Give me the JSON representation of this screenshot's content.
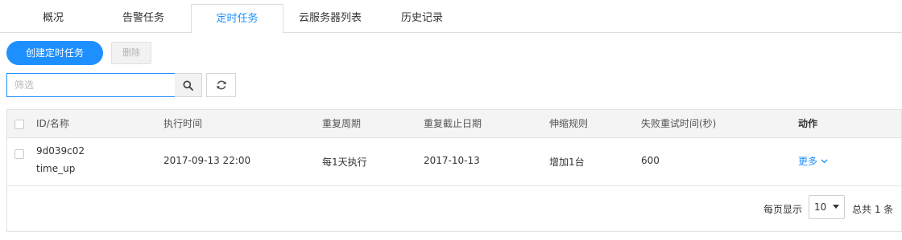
{
  "tabs": [
    {
      "label": "概况"
    },
    {
      "label": "告警任务"
    },
    {
      "label": "定时任务"
    },
    {
      "label": "云服务器列表"
    },
    {
      "label": "历史记录"
    }
  ],
  "toolbar": {
    "create_label": "创建定时任务",
    "delete_label": "删除"
  },
  "search": {
    "placeholder": "筛选"
  },
  "table": {
    "columns": [
      "ID/名称",
      "执行时间",
      "重复周期",
      "重复截止日期",
      "伸缩规则",
      "失败重试时间(秒)",
      "动作"
    ],
    "rows": [
      {
        "id": "9d039c02",
        "name": "time_up",
        "exec_time": "2017-09-13 22:00",
        "repeat": "每1天执行",
        "end_date": "2017-10-13",
        "rule": "增加1台",
        "retry": "600",
        "action": "更多"
      }
    ]
  },
  "pagination": {
    "per_page_label": "每页显示",
    "per_page_value": "10",
    "total_label": "总共 1 条"
  },
  "colors": {
    "accent": "#1e8fff",
    "header_bg": "#f4f4f4",
    "border": "#e1e1e1"
  }
}
